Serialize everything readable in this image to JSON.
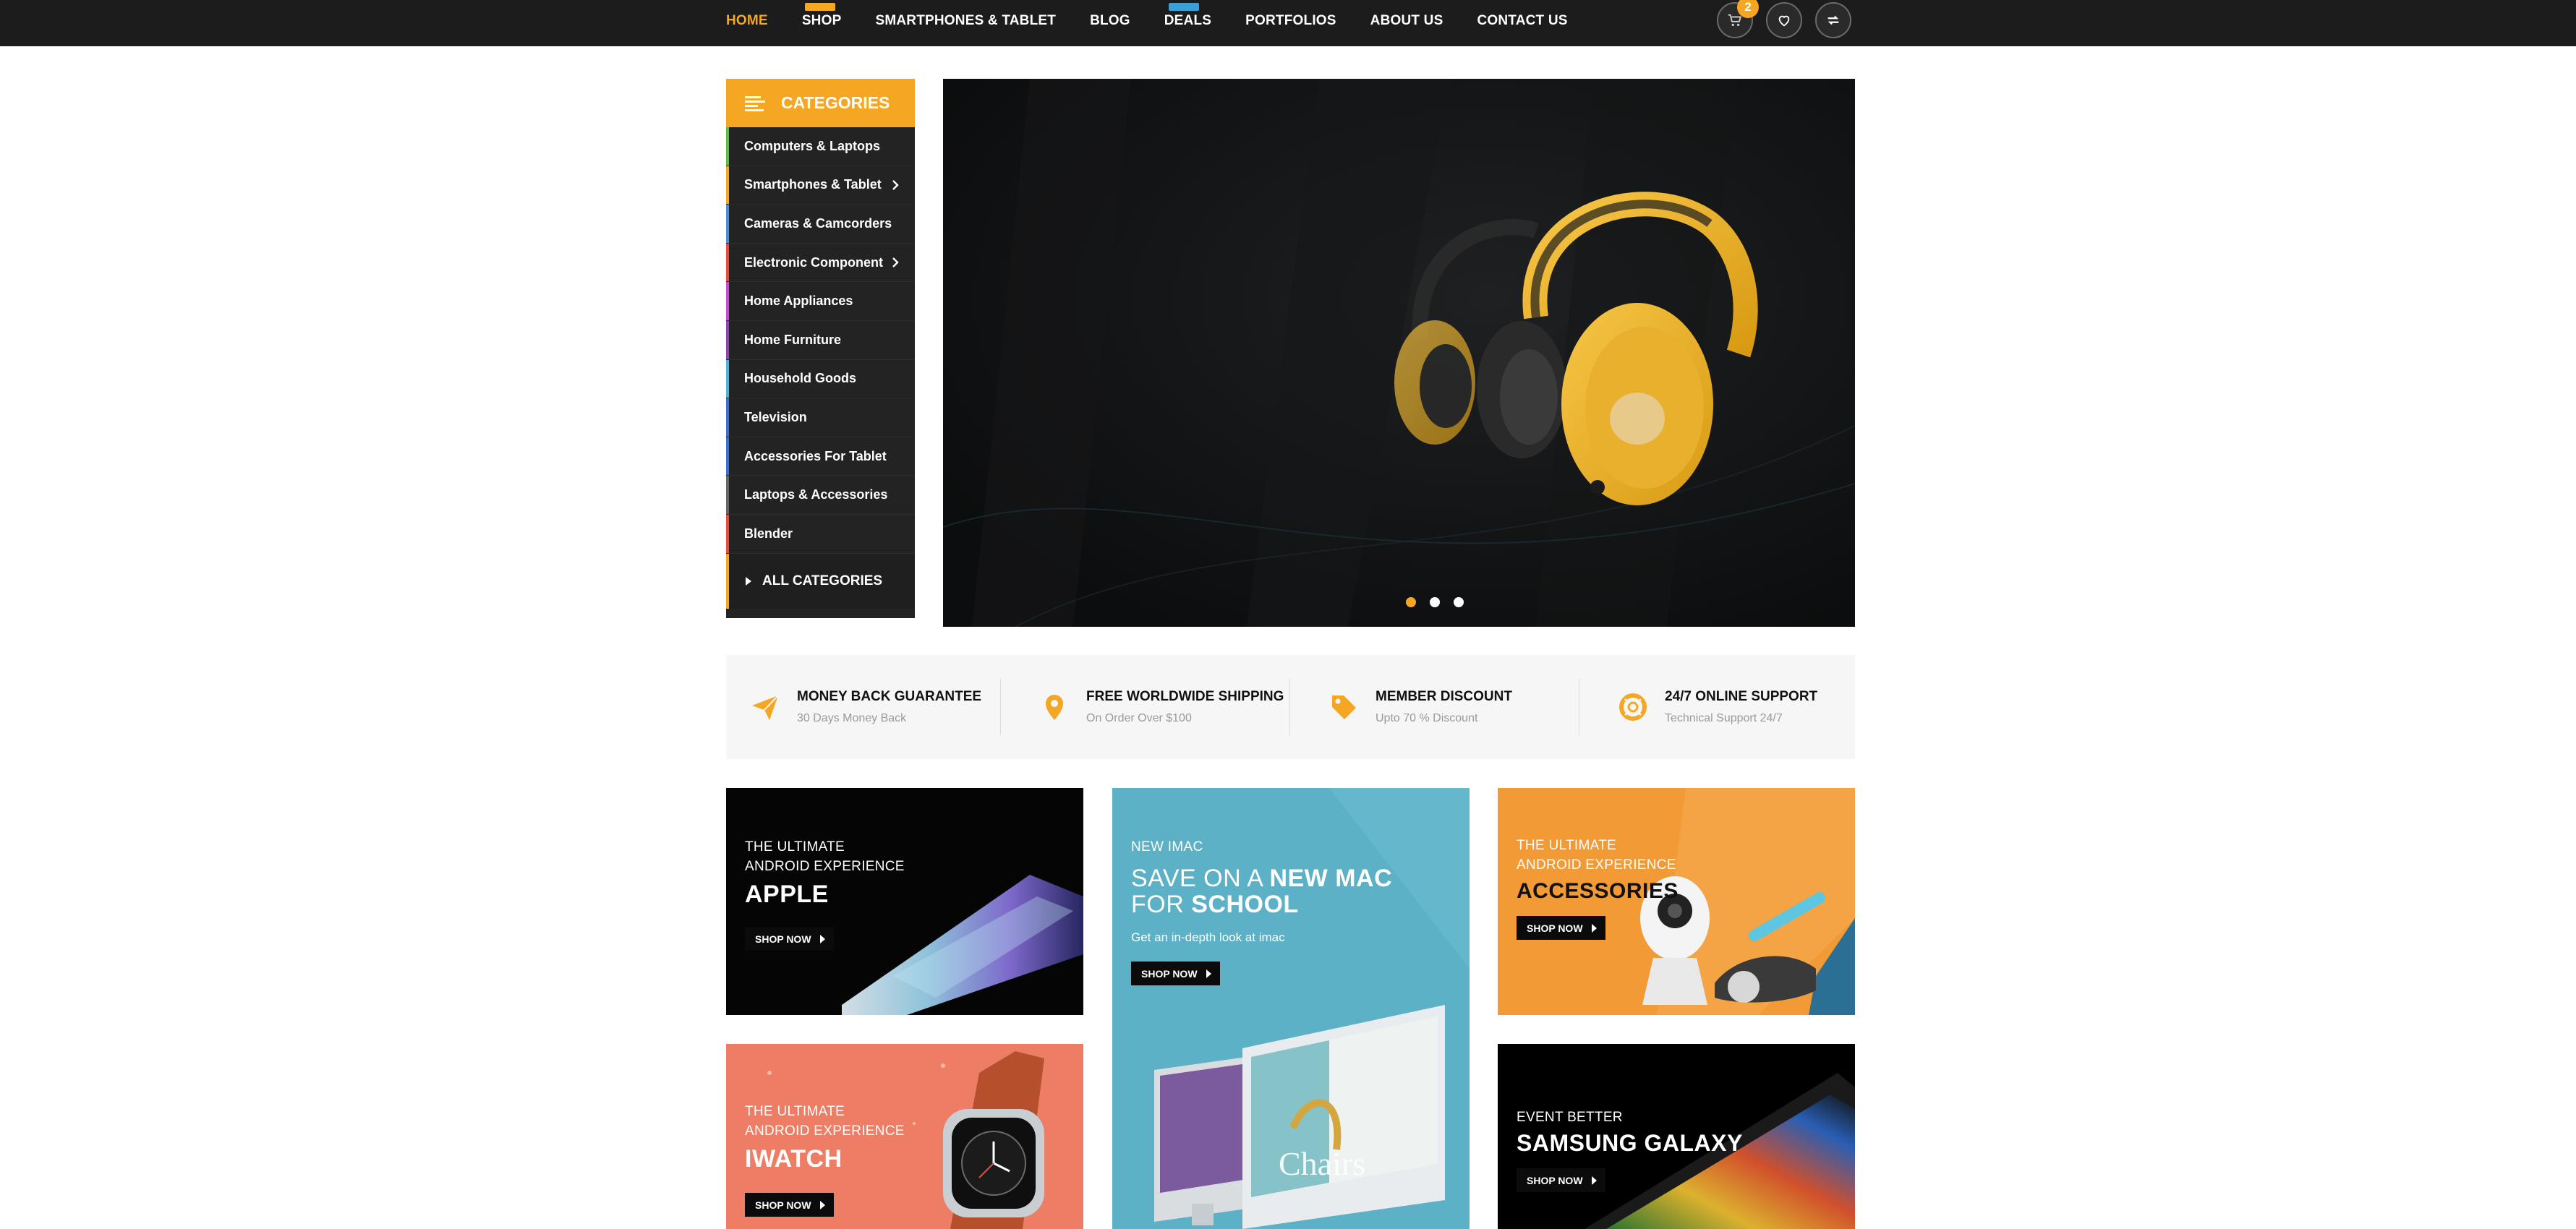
{
  "nav": {
    "items": [
      "HOME",
      "SHOP",
      "SMARTPHONES & TABLET",
      "BLOG",
      "DEALS",
      "PORTFOLIOS",
      "ABOUT US",
      "CONTACT US"
    ],
    "active": "HOME",
    "cart_count": "2"
  },
  "icons": [
    "cart-icon",
    "heart-icon",
    "compare-icon"
  ],
  "colors": {
    "accent": "#f5a623",
    "nav_bg": "#1c1c1c",
    "sidebar_bg": "#232323"
  },
  "categories": {
    "title": "CATEGORIES",
    "items": [
      {
        "label": "Computers & Laptops",
        "color": "#5fba47",
        "has_sub": false
      },
      {
        "label": "Smartphones & Tablet",
        "color": "#f5a623",
        "has_sub": true
      },
      {
        "label": "Cameras & Camcorders",
        "color": "#4a90d9",
        "has_sub": false
      },
      {
        "label": "Electronic Component",
        "color": "#e84c3d",
        "has_sub": true
      },
      {
        "label": "Home Appliances",
        "color": "#c44cd1",
        "has_sub": false
      },
      {
        "label": "Home Furniture",
        "color": "#8e44ad",
        "has_sub": false
      },
      {
        "label": "Household Goods",
        "color": "#4fb3d9",
        "has_sub": false
      },
      {
        "label": "Television",
        "color": "#3b6fd4",
        "has_sub": false
      },
      {
        "label": "Accessories For Tablet",
        "color": "#3b6fd4",
        "has_sub": false
      },
      {
        "label": "Laptops & Accessories",
        "color": "#666666",
        "has_sub": false
      },
      {
        "label": "Blender",
        "color": "#e84c3d",
        "has_sub": false
      }
    ],
    "all_label": "ALL CATEGORIES"
  },
  "slider": {
    "slide_count": 3,
    "active_slide": 1
  },
  "features": [
    {
      "title": "MONEY BACK GUARANTEE",
      "sub": "30 Days Money Back",
      "icon": "paper-plane-icon"
    },
    {
      "title": "FREE WORLDWIDE SHIPPING",
      "sub": "On Order Over $100",
      "icon": "map-pin-icon"
    },
    {
      "title": "MEMBER DISCOUNT",
      "sub": "Upto 70 % Discount",
      "icon": "tag-icon"
    },
    {
      "title": "24/7 ONLINE SUPPORT",
      "sub": "Technical Support 24/7",
      "icon": "lifebuoy-icon"
    }
  ],
  "banners": {
    "apple": {
      "line1": "THE ULTIMATE",
      "line2": "ANDROID EXPERIENCE",
      "title": "APPLE",
      "button": "SHOP NOW"
    },
    "imac": {
      "kicker": "NEW IMAC",
      "title_a": "SAVE ON A ",
      "title_b": "NEW MAC",
      "title_c": "FOR ",
      "title_d": "SCHOOL",
      "sub": "Get an in-depth look at imac",
      "button": "SHOP NOW",
      "screen_text": "Chairs"
    },
    "accessories": {
      "line1": "THE ULTIMATE",
      "line2": "ANDROID EXPERIENCE",
      "title": "ACCESSORIES",
      "button": "SHOP NOW"
    },
    "iwatch": {
      "line1": "THE ULTIMATE",
      "line2": "ANDROID EXPERIENCE",
      "title": "IWATCH",
      "button": "SHOP NOW"
    },
    "samsung": {
      "line1": "EVENT BETTER",
      "title": "SAMSUNG GALAXY",
      "button": "SHOP NOW"
    }
  }
}
